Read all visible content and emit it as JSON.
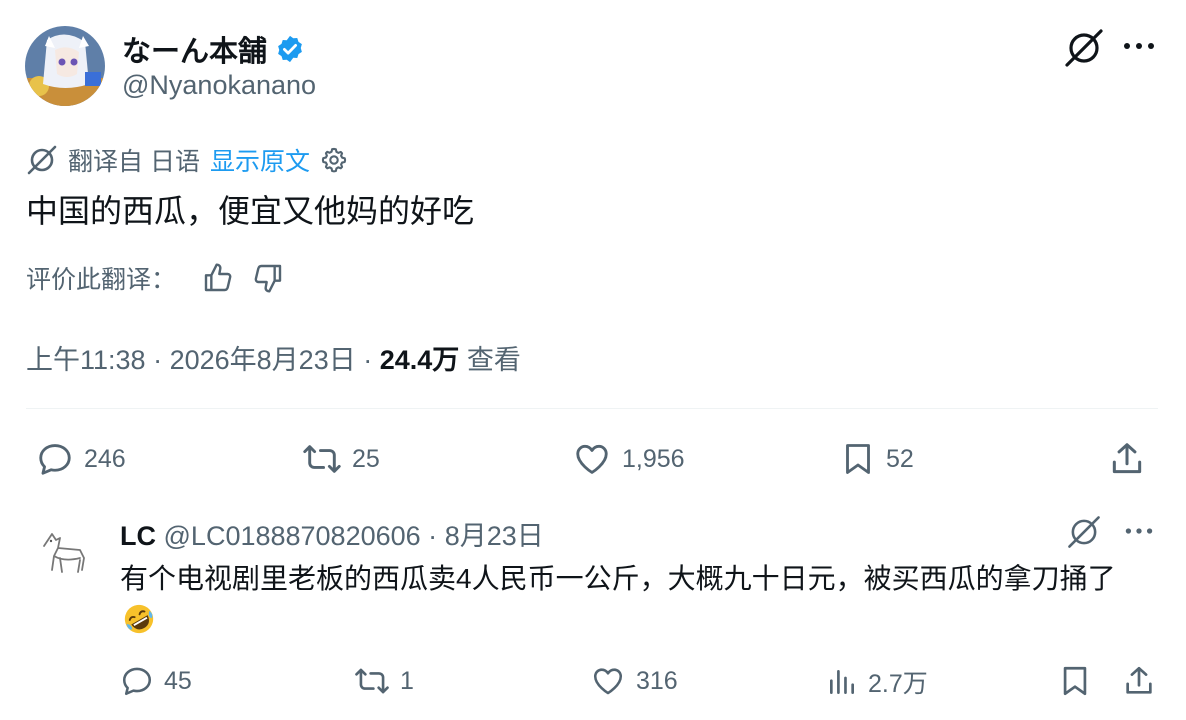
{
  "tweet": {
    "author": {
      "name": "なーん本舗",
      "handle": "@Nyanokanano",
      "verified": true
    },
    "translation": {
      "label": "翻译自 日语",
      "show_original": "显示原文",
      "text": "中国的西瓜，便宜又他妈的好吃",
      "rate_label": "评价此翻译："
    },
    "meta": {
      "time": "上午11:38",
      "date": "2026年8月23日",
      "sep": "·",
      "views": "24.4万",
      "views_label": "查看"
    },
    "actions": {
      "replies": "246",
      "reposts": "25",
      "likes": "1,956",
      "bookmarks": "52"
    }
  },
  "reply": {
    "name": "LC",
    "handle": "@LC0188870820606",
    "sep": "·",
    "date": "8月23日",
    "text": "有个电视剧里老板的西瓜卖4人民币一公斤，大概九十日元，被买西瓜的拿刀捅了",
    "emoji_icon": "rolling-on-floor-laughing",
    "actions": {
      "replies": "45",
      "reposts": "1",
      "likes": "316",
      "views": "2.7万"
    }
  },
  "colors": {
    "text": "#0f1419",
    "secondary": "#536471",
    "link": "#1d9bf0",
    "verified": "#1d9bf0",
    "divider": "#eff3f4"
  }
}
